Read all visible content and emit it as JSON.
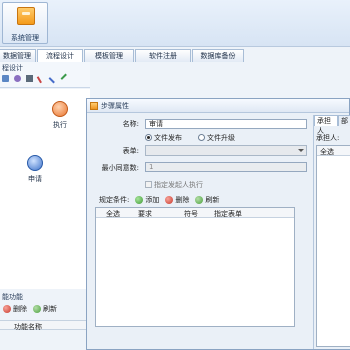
{
  "ribbon": {
    "system_button": "系统管理"
  },
  "tabs": [
    "数据管理",
    "流程设计",
    "模板管理",
    "软件注册",
    "数据库备份"
  ],
  "left": {
    "breadcrumb": "程设计",
    "nodes": [
      {
        "label": "执行"
      },
      {
        "label": "申请"
      }
    ],
    "bottom_title": "能功能",
    "bottom_actions": {
      "delete": "删除",
      "refresh": "刷新"
    },
    "bottom_header": "功能名称"
  },
  "dialog": {
    "title": "步骤属性",
    "name_label": "名称:",
    "name_value": "审请",
    "form_label": "表单:",
    "radio_publish": "文件发布",
    "radio_upgrade": "文件升级",
    "min_label": "最小同意数:",
    "min_value": "1",
    "checkbox_label": "指定发起人执行",
    "cond_label": "规定条件:",
    "btn_add": "添加",
    "btn_delete": "删除",
    "btn_refresh": "刷新",
    "table_headers": [
      "全选",
      "要求",
      "符号",
      "指定表单"
    ],
    "right_tabs": [
      "承担人",
      "部"
    ],
    "right_label": "承担人:",
    "right_header": "全选"
  }
}
